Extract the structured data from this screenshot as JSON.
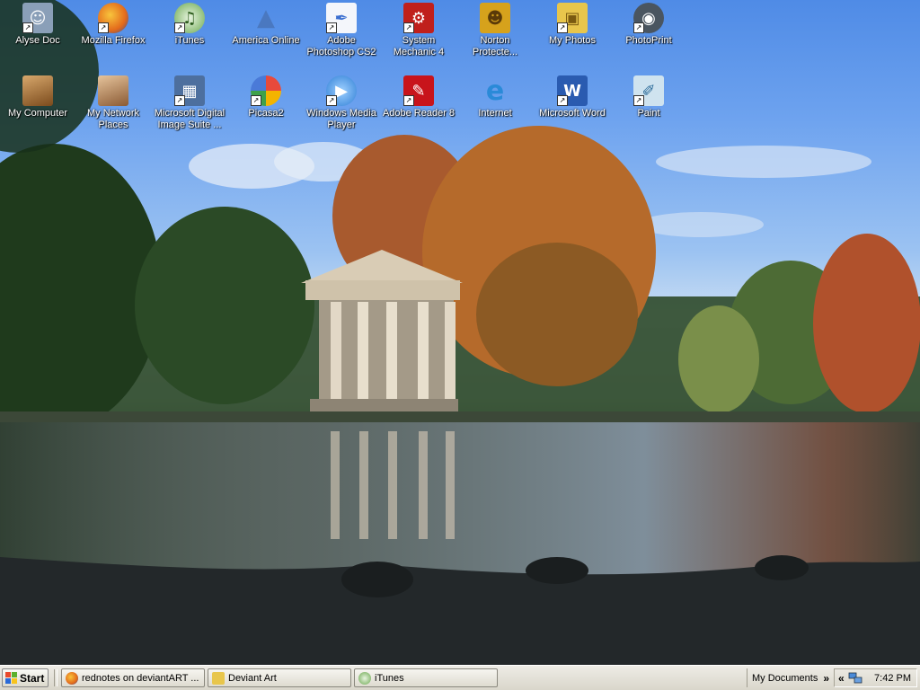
{
  "desktop": {
    "icons": [
      {
        "label": "Alyse Doc",
        "icon": "anime-portrait-icon",
        "color": "#8a9fb8"
      },
      {
        "label": "Mozilla Firefox",
        "icon": "firefox-icon",
        "color": "#e36a1b"
      },
      {
        "label": "iTunes",
        "icon": "itunes-icon",
        "color": "#6aa84f"
      },
      {
        "label": "America Online",
        "icon": "aol-icon",
        "color": "#4a78c0"
      },
      {
        "label": "Adobe Photoshop CS2",
        "icon": "photoshop-feather-icon",
        "color": "#3b6fd0"
      },
      {
        "label": "System Mechanic 4",
        "icon": "system-mechanic-icon",
        "color": "#c0201c"
      },
      {
        "label": "Norton Protecte...",
        "icon": "norton-icon",
        "color": "#d6a21c"
      },
      {
        "label": "My Photos",
        "icon": "folder-photos-icon",
        "color": "#e8c64c"
      },
      {
        "label": "PhotoPrint",
        "icon": "photoprint-icon",
        "color": "#4a5560"
      },
      {
        "label": "My Computer",
        "icon": "portrait-icon",
        "color": "#b07a3c"
      },
      {
        "label": "My Network Places",
        "icon": "portrait-icon",
        "color": "#c49a6c"
      },
      {
        "label": "Microsoft Digital Image Suite ...",
        "icon": "digital-image-icon",
        "color": "#4d6f9e"
      },
      {
        "label": "Picasa2",
        "icon": "picasa-icon",
        "color": "#e84a3c"
      },
      {
        "label": "Windows Media Player",
        "icon": "media-player-icon",
        "color": "#2f7fd6"
      },
      {
        "label": "Adobe Reader 8",
        "icon": "adobe-reader-icon",
        "color": "#c8141b"
      },
      {
        "label": "Internet",
        "icon": "internet-explorer-icon",
        "color": "#2a8ad8"
      },
      {
        "label": "Microsoft Word",
        "icon": "word-icon",
        "color": "#2a5bb0"
      },
      {
        "label": "Paint",
        "icon": "paint-icon",
        "color": "#5aa0c8"
      }
    ]
  },
  "taskbar": {
    "start_label": "Start",
    "tasks": [
      {
        "label": "rednotes on deviantART ...",
        "icon": "firefox-icon",
        "color": "#e36a1b"
      },
      {
        "label": "Deviant Art",
        "icon": "folder-icon",
        "color": "#e8c64c"
      },
      {
        "label": "iTunes",
        "icon": "itunes-icon",
        "color": "#6aa84f"
      }
    ],
    "toolbar_label": "My Documents",
    "toolbar_chevron": "»",
    "tray_chevron": "«",
    "clock": "7:42 PM"
  }
}
